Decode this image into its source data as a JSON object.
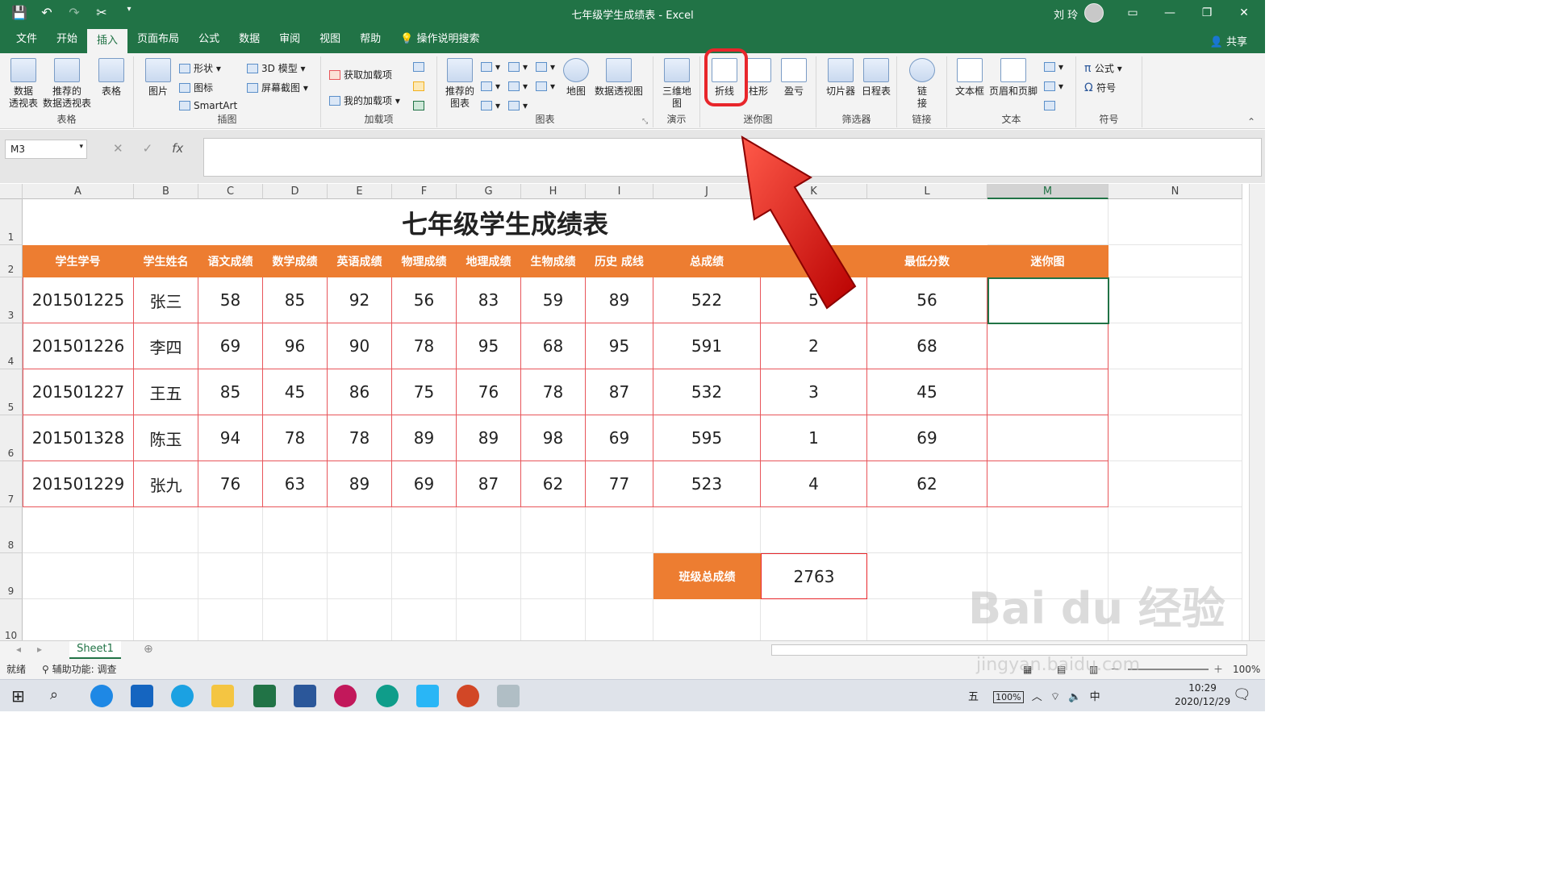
{
  "app": {
    "window_title": "七年级学生成绩表 - Excel",
    "user": "刘 玲"
  },
  "tabs": [
    "文件",
    "开始",
    "插入",
    "页面布局",
    "公式",
    "数据",
    "审阅",
    "视图",
    "帮助",
    "操作说明搜索"
  ],
  "share": "共享",
  "ribbon": {
    "table_group": {
      "name": "表格",
      "pivot": "数据\n透视表",
      "recpivot": "推荐的\n数据透视表",
      "table": "表格"
    },
    "illus_group": {
      "name": "插图",
      "pictures": "图片",
      "shapes": "形状",
      "icons": "图标",
      "model3d": "3D 模型",
      "smartart": "SmartArt",
      "screenshot": "屏幕截图"
    },
    "addins_group": {
      "name": "加载项",
      "get": "获取加载项",
      "mine": "我的加载项"
    },
    "charts_group": {
      "name": "图表",
      "rec": "推荐的\n图表",
      "maps": "地图",
      "pivotchart": "数据透视图"
    },
    "tour_group": {
      "name": "演示",
      "map3d": "三维地\n图"
    },
    "spark_group": {
      "name": "迷你图",
      "line": "折线",
      "column": "柱形",
      "winloss": "盈亏"
    },
    "filter_group": {
      "name": "筛选器",
      "slicer": "切片器",
      "timeline": "日程表"
    },
    "links_group": {
      "name": "链接",
      "link": "链\n接"
    },
    "text_group": {
      "name": "文本",
      "textbox": "文本框",
      "headerfooter": "页眉和页脚"
    },
    "symbols_group": {
      "name": "符号",
      "equation": "公式",
      "symbol": "符号"
    }
  },
  "formula_bar": {
    "name_box": "M3",
    "fx": "fx",
    "value": ""
  },
  "columns": [
    "A",
    "B",
    "C",
    "D",
    "E",
    "F",
    "G",
    "H",
    "I",
    "J",
    "K",
    "L",
    "M",
    "N"
  ],
  "rows": [
    "1",
    "2",
    "3",
    "4",
    "5",
    "6",
    "7",
    "8",
    "9",
    "10"
  ],
  "sheet": {
    "title": "七年级学生成绩表",
    "headers": [
      "学生学号",
      "学生姓名",
      "语文成绩",
      "数学成绩",
      "英语成绩",
      "物理成绩",
      "地理成绩",
      "生物成绩",
      "历史 成线",
      "总成绩",
      "",
      "最低分数",
      "迷你图"
    ],
    "data": [
      [
        "201501225",
        "张三",
        "58",
        "85",
        "92",
        "56",
        "83",
        "59",
        "89",
        "522",
        "5",
        "56",
        ""
      ],
      [
        "201501226",
        "李四",
        "69",
        "96",
        "90",
        "78",
        "95",
        "68",
        "95",
        "591",
        "2",
        "68",
        ""
      ],
      [
        "201501227",
        "王五",
        "85",
        "45",
        "86",
        "75",
        "76",
        "78",
        "87",
        "532",
        "3",
        "45",
        ""
      ],
      [
        "201501328",
        "陈玉",
        "94",
        "78",
        "78",
        "89",
        "89",
        "98",
        "69",
        "595",
        "1",
        "69",
        ""
      ],
      [
        "201501229",
        "张九",
        "76",
        "63",
        "89",
        "69",
        "87",
        "62",
        "77",
        "523",
        "4",
        "62",
        ""
      ]
    ],
    "summary_label": "班级总成绩",
    "summary_value": "2763"
  },
  "sheet_tab": "Sheet1",
  "status": {
    "ready": "就绪",
    "accessibility": "辅助功能: 调查",
    "zoom": "100%"
  },
  "taskbar": {
    "time": "10:29",
    "date": "2020/12/29",
    "ime": "中",
    "ime2": "五",
    "battery": "100%"
  },
  "watermark": {
    "line1": "Bai du 经验",
    "line2": "jingyan.baidu.com"
  },
  "colors": {
    "excel_green": "#217346",
    "header_orange": "#ed7d31",
    "border_red": "#e8555a",
    "highlight_red": "#e8262b"
  }
}
